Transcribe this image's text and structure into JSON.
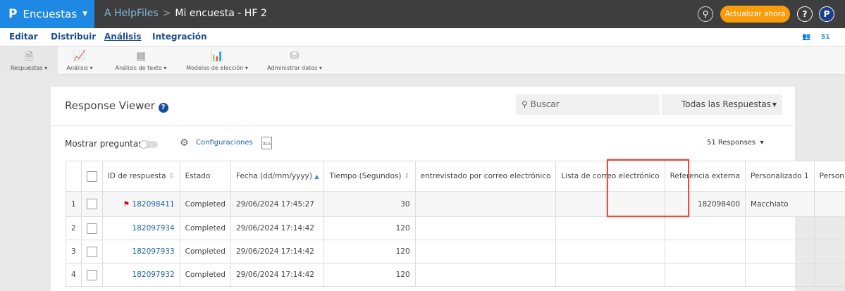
{
  "header": {
    "app": "Encuestas",
    "project": "A HelpFiles",
    "survey": "Mi encuesta - HF 2",
    "upgrade": "Actualizar ahora",
    "help": "?",
    "user": "P"
  },
  "nav": {
    "tabs": [
      "Editar",
      "Distribuir",
      "Análisis",
      "Integración"
    ],
    "active": "Análisis",
    "count": "51"
  },
  "toolbar": [
    "Respuestas",
    "Análisis",
    "Análisis de texto",
    "Modelos de elección",
    "Administrar datos"
  ],
  "viewer": {
    "title": "Response Viewer",
    "search_placeholder": "Buscar",
    "filter": "Todas las Respuestas",
    "show_questions": "Mostrar preguntas",
    "settings": "Configuraciones",
    "xls": "XLS",
    "responses": "51 Responses"
  },
  "table": {
    "columns": [
      "ID de respuesta",
      "Estado",
      "Fecha (dd/mm/yyyy)",
      "Tiempo (Segundos)",
      "entrevistado por correo electrónico",
      "Lista de correo electrónico",
      "Referencia externa",
      "Personalizado 1",
      "Person"
    ],
    "rows": [
      {
        "n": "1",
        "id": "182098411",
        "estado": "Completed",
        "fecha": "29/06/2024 17:45:27",
        "tiempo": "30",
        "ref": "182098400",
        "p1": "Macchiato"
      },
      {
        "n": "2",
        "id": "182097934",
        "estado": "Completed",
        "fecha": "29/06/2024 17:14:42",
        "tiempo": "120",
        "ref": "",
        "p1": ""
      },
      {
        "n": "3",
        "id": "182097933",
        "estado": "Completed",
        "fecha": "29/06/2024 17:14:42",
        "tiempo": "120",
        "ref": "",
        "p1": ""
      },
      {
        "n": "4",
        "id": "182097932",
        "estado": "Completed",
        "fecha": "29/06/2024 17:14:42",
        "tiempo": "120",
        "ref": "",
        "p1": ""
      }
    ]
  }
}
